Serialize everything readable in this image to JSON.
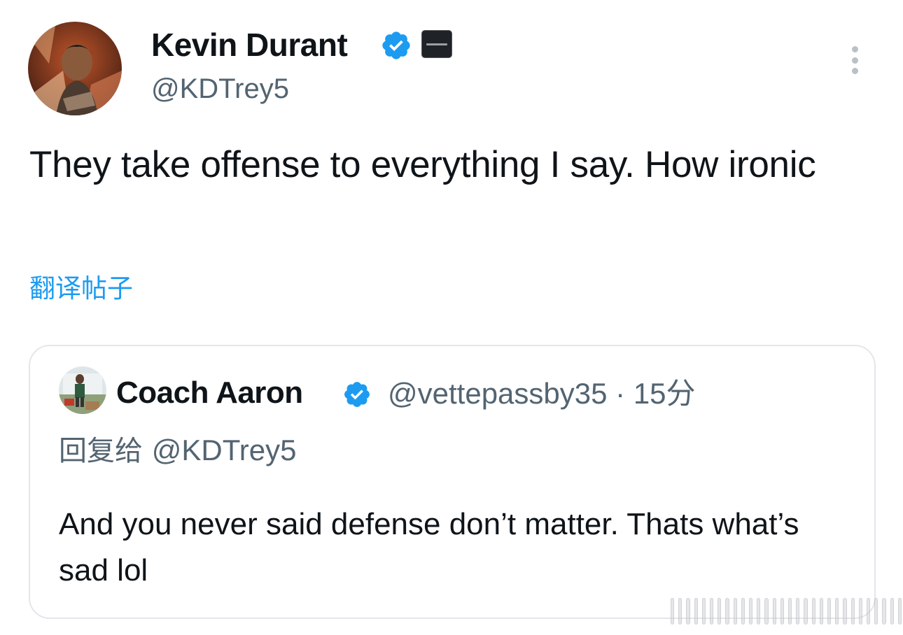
{
  "author": {
    "name": "Kevin Durant",
    "handle": "@KDTrey5"
  },
  "tweet": {
    "text": "They take offense to everything I say. How ironic",
    "translate_label": "翻译帖子"
  },
  "quoted_tweet": {
    "name": "Coach Aaron",
    "handle": "@vettepassby35",
    "separator": "·",
    "time": "15分",
    "reply_prefix": "回复给",
    "reply_to": "@KDTrey5",
    "text": "And you never said defense don’t matter. Thats what’s sad lol"
  },
  "icons": {
    "verified": "verified-badge-icon",
    "affiliate": "affiliate-badge-icon",
    "more": "more-options-icon"
  },
  "colors": {
    "link_blue": "#1d9bf0",
    "secondary_text": "#536471",
    "primary_text": "#0f1419",
    "border": "#e3e7ea"
  }
}
